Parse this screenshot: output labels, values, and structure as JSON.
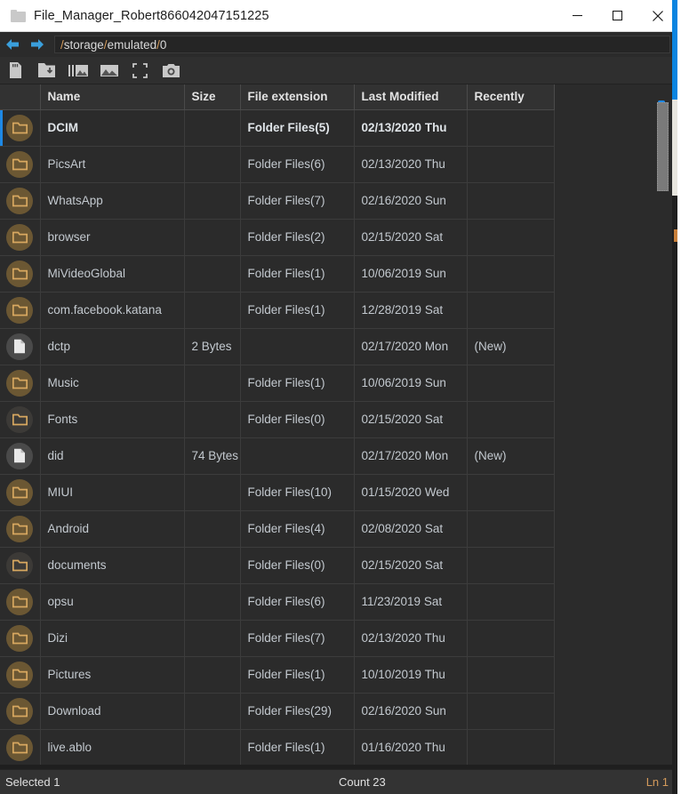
{
  "window": {
    "title": "File_Manager_Robert866042047151225",
    "title_icon": "folder-icon",
    "controls": {
      "minimize": "minimize-icon",
      "maximize": "maximize-icon",
      "close": "close-icon"
    }
  },
  "nav": {
    "back_icon": "arrow-left-icon",
    "forward_icon": "arrow-right-icon",
    "path": "/storage/emulated/0",
    "path_placeholder": "/storage/emulated/0"
  },
  "toolbar": {
    "items": [
      {
        "icon": "sd-card-icon",
        "label": "SD Card"
      },
      {
        "icon": "folder-download-icon",
        "label": "Download Folder"
      },
      {
        "icon": "image-list-icon",
        "label": "Image List"
      },
      {
        "icon": "image-icon",
        "label": "Image"
      },
      {
        "icon": "fullscreen-icon",
        "label": "Fullscreen"
      },
      {
        "icon": "camera-icon",
        "label": "Camera"
      }
    ]
  },
  "table": {
    "columns": [
      "",
      "Name",
      "Size",
      "File extension",
      "Last Modified",
      "Recently"
    ],
    "rows": [
      {
        "icon": "folder",
        "name": "DCIM",
        "size": "",
        "ext": "Folder Files(5)",
        "modified": "02/13/2020 Thu",
        "recently": "",
        "selected": true
      },
      {
        "icon": "folder",
        "name": "PicsArt",
        "size": "",
        "ext": "Folder Files(6)",
        "modified": "02/13/2020 Thu",
        "recently": "",
        "selected": false
      },
      {
        "icon": "folder",
        "name": "WhatsApp",
        "size": "",
        "ext": "Folder Files(7)",
        "modified": "02/16/2020 Sun",
        "recently": "",
        "selected": false
      },
      {
        "icon": "folder",
        "name": "browser",
        "size": "",
        "ext": "Folder Files(2)",
        "modified": "02/15/2020 Sat",
        "recently": "",
        "selected": false
      },
      {
        "icon": "folder",
        "name": "MiVideoGlobal",
        "size": "",
        "ext": "Folder Files(1)",
        "modified": "10/06/2019 Sun",
        "recently": "",
        "selected": false
      },
      {
        "icon": "folder",
        "name": "com.facebook.katana",
        "size": "",
        "ext": "Folder Files(1)",
        "modified": "12/28/2019 Sat",
        "recently": "",
        "selected": false
      },
      {
        "icon": "file",
        "name": "dctp",
        "size": "2 Bytes",
        "ext": "",
        "modified": "02/17/2020 Mon",
        "recently": "(New)",
        "selected": false
      },
      {
        "icon": "folder",
        "name": "Music",
        "size": "",
        "ext": "Folder Files(1)",
        "modified": "10/06/2019 Sun",
        "recently": "",
        "selected": false
      },
      {
        "icon": "folder-empty",
        "name": "Fonts",
        "size": "",
        "ext": "Folder Files(0)",
        "modified": "02/15/2020 Sat",
        "recently": "",
        "selected": false
      },
      {
        "icon": "file",
        "name": "did",
        "size": "74 Bytes",
        "ext": "",
        "modified": "02/17/2020 Mon",
        "recently": "(New)",
        "selected": false
      },
      {
        "icon": "folder",
        "name": "MIUI",
        "size": "",
        "ext": "Folder Files(10)",
        "modified": "01/15/2020 Wed",
        "recently": "",
        "selected": false
      },
      {
        "icon": "folder",
        "name": "Android",
        "size": "",
        "ext": "Folder Files(4)",
        "modified": "02/08/2020 Sat",
        "recently": "",
        "selected": false
      },
      {
        "icon": "folder-empty",
        "name": "documents",
        "size": "",
        "ext": "Folder Files(0)",
        "modified": "02/15/2020 Sat",
        "recently": "",
        "selected": false
      },
      {
        "icon": "folder",
        "name": "opsu",
        "size": "",
        "ext": "Folder Files(6)",
        "modified": "11/23/2019 Sat",
        "recently": "",
        "selected": false
      },
      {
        "icon": "folder",
        "name": "Dizi",
        "size": "",
        "ext": "Folder Files(7)",
        "modified": "02/13/2020 Thu",
        "recently": "",
        "selected": false
      },
      {
        "icon": "folder",
        "name": "Pictures",
        "size": "",
        "ext": "Folder Files(1)",
        "modified": "10/10/2019 Thu",
        "recently": "",
        "selected": false
      },
      {
        "icon": "folder",
        "name": "Download",
        "size": "",
        "ext": "Folder Files(29)",
        "modified": "02/16/2020 Sun",
        "recently": "",
        "selected": false
      },
      {
        "icon": "folder",
        "name": "live.ablo",
        "size": "",
        "ext": "Folder Files(1)",
        "modified": "01/16/2020 Thu",
        "recently": "",
        "selected": false
      }
    ]
  },
  "statusbar": {
    "selected": "Selected 1",
    "count": "Count 23",
    "line": "Ln 1"
  },
  "colors": {
    "accent_blue": "#1e88e5",
    "folder_gold": "#d8a860",
    "new_teal": "#3fb8a8",
    "path_sep": "#d39a5b",
    "window_bg": "#2b2b2b"
  }
}
